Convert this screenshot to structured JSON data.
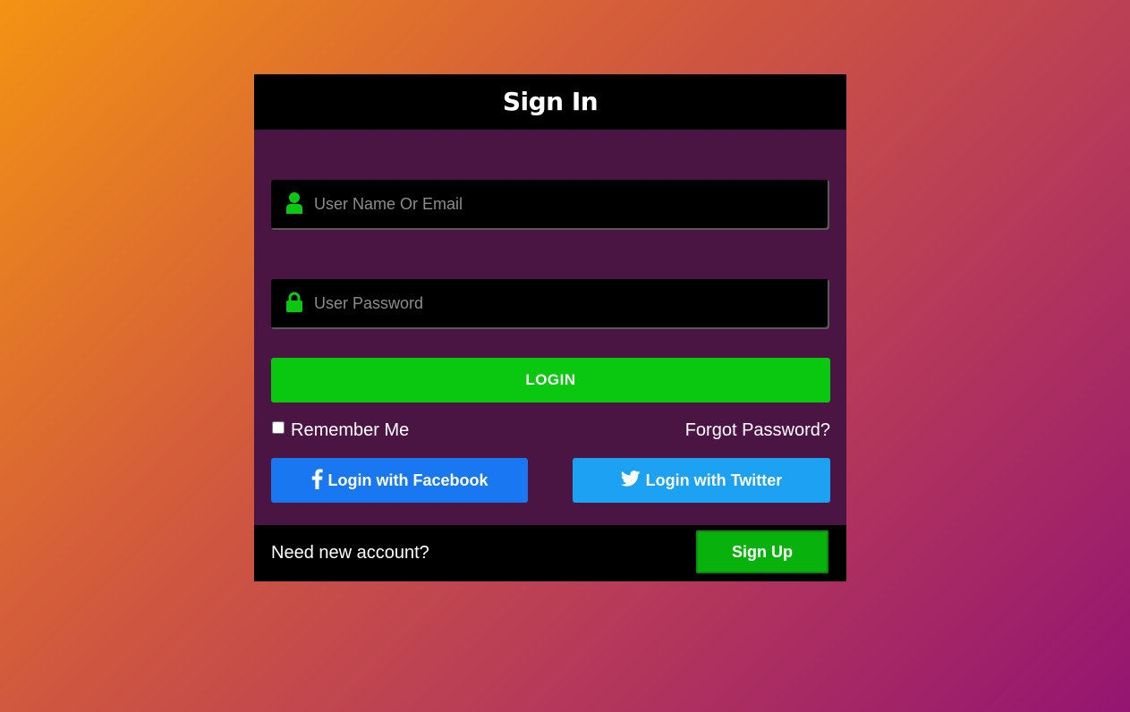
{
  "form": {
    "title": "Sign In",
    "username_placeholder": "User Name Or Email",
    "password_placeholder": "User Password",
    "login_label": "LOGIN",
    "remember_label": "Remember Me",
    "forgot_label": "Forgot Password?",
    "facebook_label": "Login with Facebook",
    "twitter_label": "Login with Twitter",
    "footer_text": "Need new account?",
    "signup_label": "Sign Up"
  },
  "icons": {
    "username": "user-icon",
    "password": "lock-icon",
    "facebook": "facebook-icon",
    "twitter": "twitter-icon"
  },
  "colors": {
    "accent_green": "#0ac70f",
    "facebook_blue": "#1a77f2",
    "twitter_blue": "#1da1f2",
    "card_background": "#4a1443"
  }
}
